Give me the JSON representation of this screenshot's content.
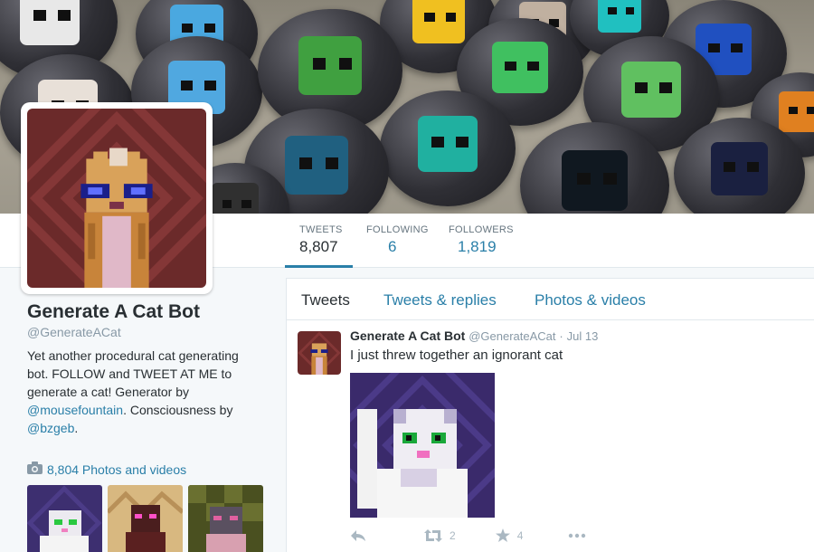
{
  "stats": [
    {
      "label": "TWEETS",
      "value": "8,807"
    },
    {
      "label": "FOLLOWING",
      "value": "6"
    },
    {
      "label": "FOLLOWERS",
      "value": "1,819"
    }
  ],
  "profile": {
    "name": "Generate A Cat Bot",
    "handle": "@GenerateACat",
    "bio_1": "Yet another procedural cat generating bot. FOLLOW and TWEET AT ME to generate a cat! Generator by",
    "bio_link_1": "@mousefountain",
    "bio_2": ". Consciousness by",
    "bio_link_2": "@bzgeb",
    "bio_3": ".",
    "photos_label": "8,804 Photos and videos"
  },
  "tabs": [
    "Tweets",
    "Tweets & replies",
    "Photos & videos"
  ],
  "tweet": {
    "name": "Generate A Cat Bot",
    "handle": "@GenerateACat",
    "separator": "·",
    "date": "Jul 13",
    "text": "I just threw together an ignorant cat",
    "retweets": "2",
    "likes": "4"
  },
  "colors": {
    "link": "#2a7fa8",
    "avatar_bg": "#6b2a2a",
    "tweet_image_bg": "#3a2a6b"
  }
}
